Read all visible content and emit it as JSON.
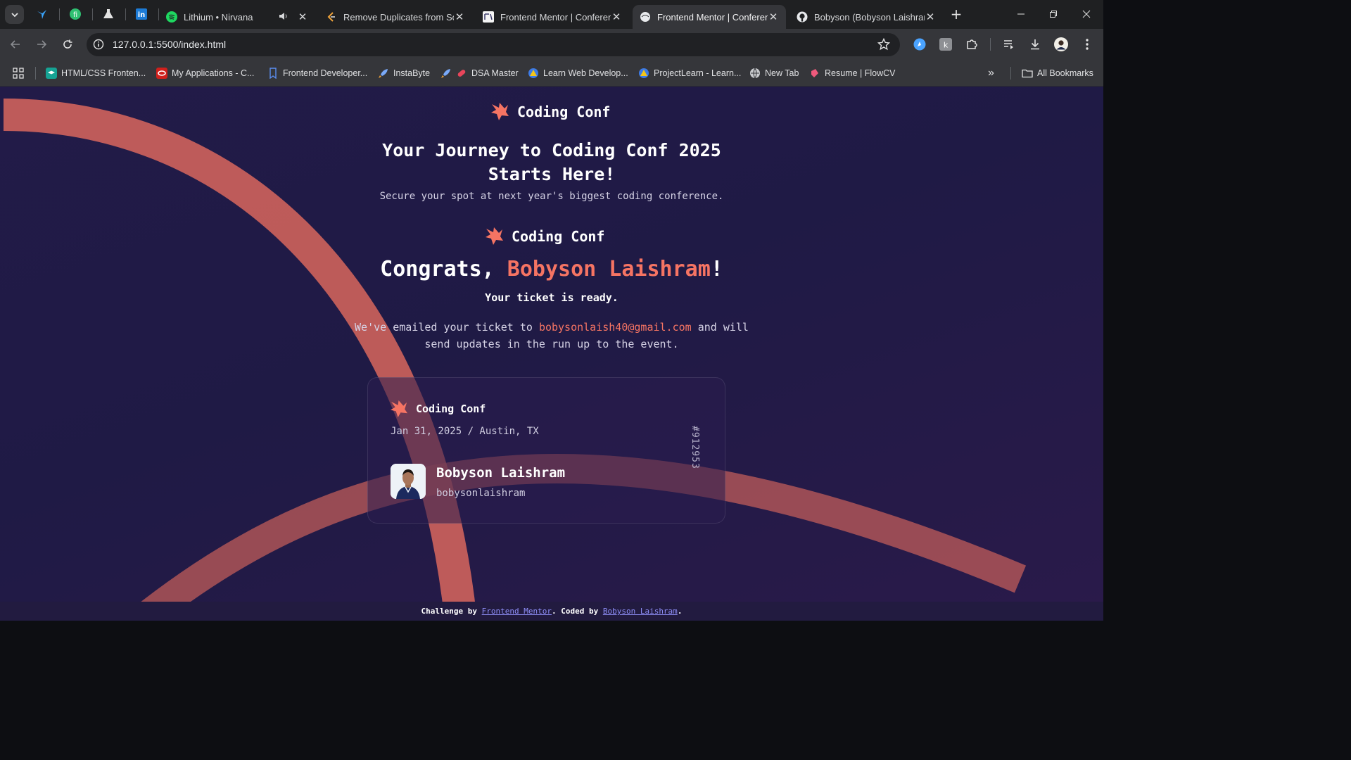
{
  "browser": {
    "tabs": [
      {
        "title": "Lithium • Nirvana",
        "has_audio": true
      },
      {
        "title": "Remove Duplicates from Sorted Array"
      },
      {
        "title": "Frontend Mentor | Conference ticket generator"
      },
      {
        "title": "Frontend Mentor | Conference ticket generator",
        "active": true
      },
      {
        "title": "Bobyson (Bobyson Laishram)"
      }
    ],
    "url": "127.0.0.1:5500/index.html",
    "bookmarks": [
      "HTML/CSS Fronten...",
      "My Applications - C...",
      "Frontend Developer...",
      "InstaByte",
      "DSA Master",
      "Learn Web Develop...",
      "ProjectLearn - Learn...",
      "New Tab",
      "Resume | FlowCV"
    ],
    "all_bookmarks_label": "All Bookmarks",
    "more_bookmarks": "»"
  },
  "page": {
    "brand": "Coding Conf",
    "headline_line1": "Your Journey to Coding Conf 2025",
    "headline_line2": "Starts Here!",
    "subtitle": "Secure your spot at next year's biggest coding conference.",
    "congrats_prefix": "Congrats, ",
    "congrats_name": "Bobyson Laishram",
    "congrats_suffix": "!",
    "ticket_ready": "Your ticket is ready.",
    "email_prefix": "We've emailed your ticket to ",
    "email": "bobysonlaish40@gmail.com",
    "email_suffix_line1": " and will",
    "email_line2": "send updates in the run up to the event.",
    "ticket": {
      "brand": "Coding Conf",
      "date_location": "Jan 31, 2025 / Austin, TX",
      "name": "Bobyson Laishram",
      "username": "bobysonlaishram",
      "number": "#912953"
    },
    "footer": {
      "prefix": "Challenge by ",
      "link1": "Frontend Mentor",
      "middle": ". Coded by ",
      "link2": "Bobyson Laishram",
      "suffix": "."
    }
  },
  "colors": {
    "accent": "#f57463",
    "page_bg": "#221b48",
    "chrome_bg": "#35363a"
  }
}
